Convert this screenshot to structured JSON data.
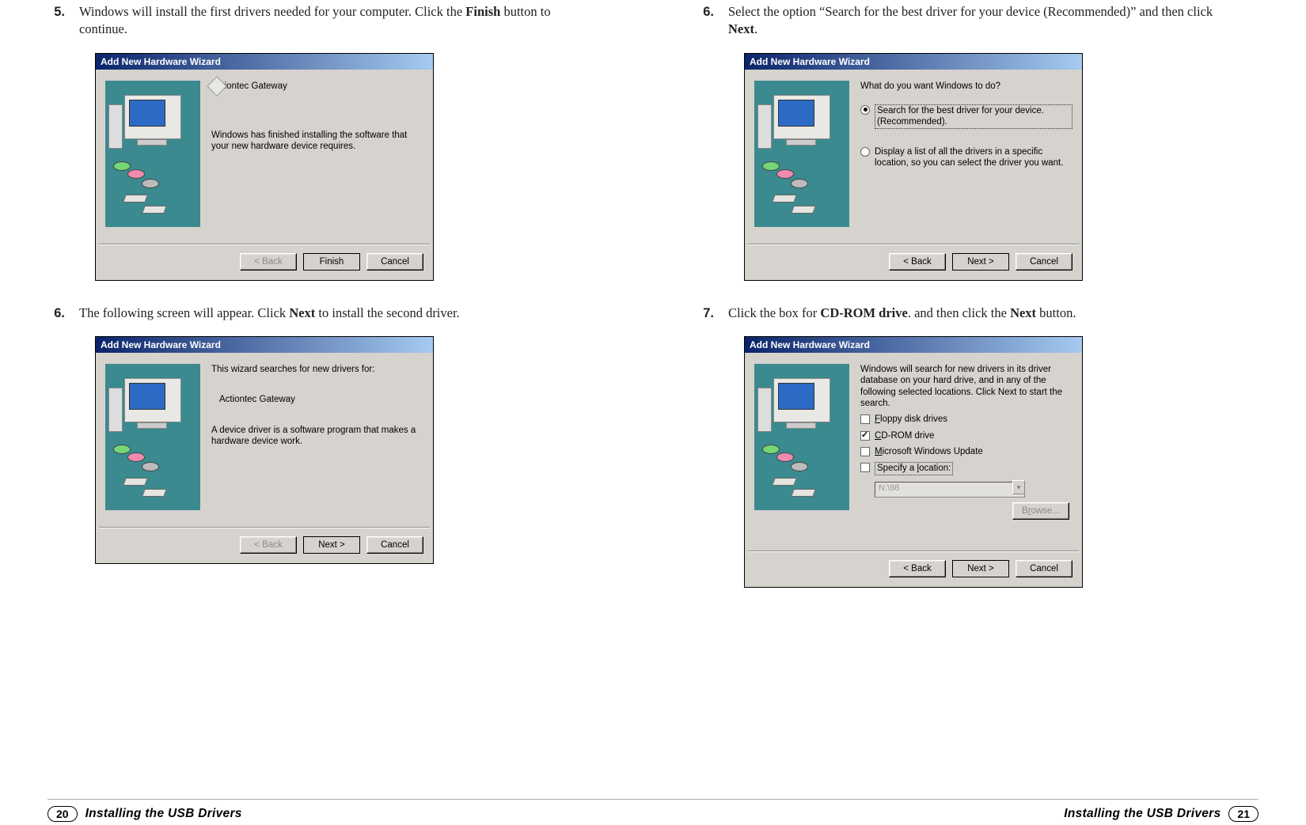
{
  "left": {
    "step5": {
      "num": "5.",
      "text": "Windows will install the first drivers needed for your computer. Click the ",
      "bold": "Finish",
      "text2": " button to continue."
    },
    "wizard1": {
      "title": "Add New Hardware Wizard",
      "line1": "Actiontec Gateway",
      "line2": "Windows has finished installing the software that your new hardware device requires.",
      "back": "< Back",
      "finish": "Finish",
      "cancel": "Cancel"
    },
    "step6": {
      "num": "6.",
      "text": "The following screen will appear. Click ",
      "bold": "Next",
      "text2": " to install the second driver."
    },
    "wizard2": {
      "title": "Add New Hardware Wizard",
      "line1": "This wizard searches for new drivers for:",
      "line2": "Actiontec Gateway",
      "line3": "A device driver is a software program that makes a hardware device work.",
      "back": "< Back",
      "next": "Next >",
      "cancel": "Cancel"
    }
  },
  "right": {
    "step6": {
      "num": "6.",
      "text": "Select the option “Search for the best driver for your device (Recommended)” and then click ",
      "bold": "Next",
      "text2": "."
    },
    "wizard3": {
      "title": "Add New Hardware Wizard",
      "prompt": "What do you want Windows to do?",
      "opt1": "Search for the best driver for your device. (Recommended).",
      "opt2": "Display a list of all the drivers in a specific location, so you can select the driver you want.",
      "back": "< Back",
      "next": "Next >",
      "cancel": "Cancel"
    },
    "step7": {
      "num": "7.",
      "text": "Click the box for ",
      "bold": "CD-ROM drive",
      "text2": ". and then click the ",
      "bold2": "Next",
      "text3": " button."
    },
    "wizard4": {
      "title": "Add New Hardware Wizard",
      "intro": "Windows will search for new drivers in its driver database on your hard drive, and in any of the following selected locations. Click Next to start the search.",
      "c1": "Floppy disk drives",
      "c2": "CD-ROM drive",
      "c3": "Microsoft Windows Update",
      "c4": "Specify a location:",
      "loc": "N:\\98",
      "browse": "Browse...",
      "back": "< Back",
      "next": "Next >",
      "cancel": "Cancel"
    }
  },
  "footer": {
    "page_left": "20",
    "page_right": "21",
    "title": "Installing the USB Drivers"
  }
}
